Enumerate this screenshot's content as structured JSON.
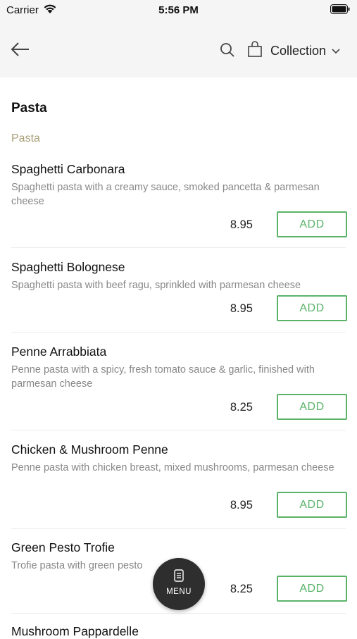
{
  "status_bar": {
    "carrier": "Carrier",
    "time": "5:56 PM"
  },
  "nav": {
    "collection_label": "Collection"
  },
  "section": {
    "title": "Pasta",
    "category": "Pasta"
  },
  "items": [
    {
      "name": "Spaghetti Carbonara",
      "description": "Spaghetti pasta with a creamy sauce, smoked pancetta & parmesan cheese",
      "price": "8.95",
      "add_label": "ADD"
    },
    {
      "name": "Spaghetti Bolognese",
      "description": "Spaghetti pasta with beef ragu, sprinkled with parmesan cheese",
      "price": "8.95",
      "add_label": "ADD"
    },
    {
      "name": "Penne Arrabbiata",
      "description": "Penne pasta with a spicy, fresh tomato sauce & garlic, finished with parmesan cheese",
      "price": "8.25",
      "add_label": "ADD"
    },
    {
      "name": "Chicken & Mushroom Penne",
      "description": "Penne pasta with chicken breast, mixed mushrooms, parmesan cheese",
      "price": "8.95",
      "add_label": "ADD"
    },
    {
      "name": "Green Pesto Trofie",
      "description": "Trofie pasta with green pesto",
      "price": "8.25",
      "add_label": "ADD"
    },
    {
      "name": "Mushroom Pappardelle"
    }
  ],
  "menu_button": {
    "label": "MENU"
  },
  "colors": {
    "accent_green": "#5bb36a",
    "category_gold": "#a89f78",
    "fab_dark": "#2e2e2e"
  }
}
